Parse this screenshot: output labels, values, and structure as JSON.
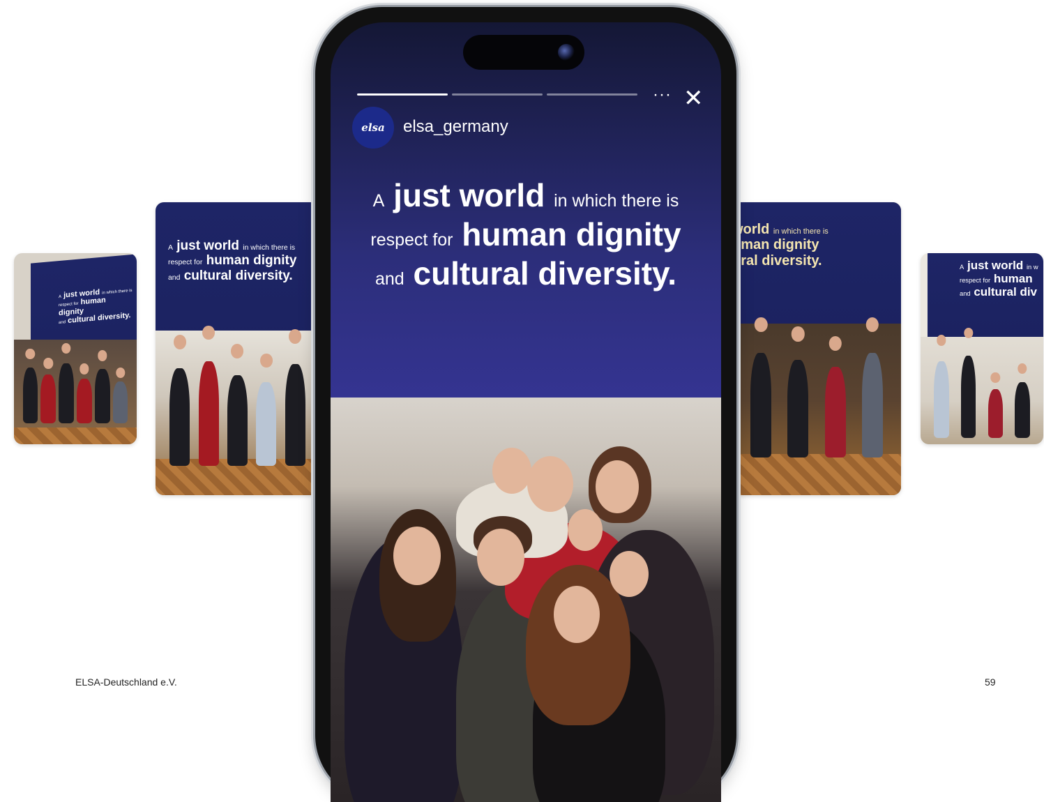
{
  "footer": {
    "organization": "ELSA-Deutschland e.V.",
    "page_number": "59"
  },
  "story": {
    "username": "elsa_germany",
    "avatar_text": "elsa",
    "more_icon": "···",
    "close_icon": "✕",
    "progress_segments_total": 3,
    "progress_segments_done": 1,
    "headline": {
      "a": "A",
      "just_world": "just world",
      "in_which": "in which there is",
      "respect_for": "respect for",
      "human_dignity": "human dignity",
      "and": "and",
      "cultural_diversity": "cultural diversity."
    }
  },
  "cards": [
    {
      "a": "A",
      "just_world": "just world",
      "in_which": "in which there is",
      "respect_for": "respect for",
      "human_dignity": "human dignity",
      "and": "and",
      "cultural_diversity": "cultural diversity."
    },
    {
      "a": "A",
      "just_world": "just world",
      "in_which": "in which there is",
      "respect_for": "respect for",
      "human_dignity": "human dignity",
      "and": "and",
      "cultural_diversity": "cultural diversity."
    },
    {
      "just_world": "world",
      "in_which": "in which there is",
      "human_dignity": "uman dignity",
      "cultural_diversity": "ural diversity."
    },
    {
      "a": "A",
      "just_world": "just world",
      "in_which": "in w",
      "respect_for": "respect for",
      "human_dignity": "human",
      "and": "and",
      "cultural_diversity": "cultural div"
    }
  ],
  "colors": {
    "wall_blue": "#1e2566",
    "story_bg": "#363596",
    "text_white": "#ffffff"
  }
}
